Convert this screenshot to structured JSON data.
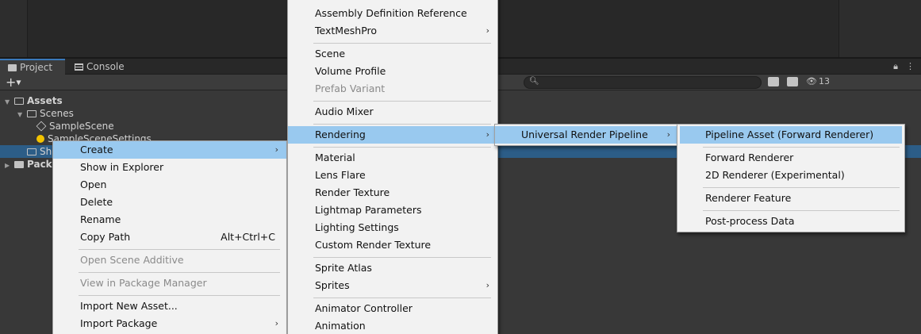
{
  "panel": {
    "tabs": [
      {
        "label": "Project",
        "icon": "folder-icon"
      },
      {
        "label": "Console",
        "icon": "console-icon"
      }
    ],
    "hidden_count": "13",
    "search_placeholder": ""
  },
  "tree": {
    "assets": "Assets",
    "scenes": "Scenes",
    "sample_scene": "SampleScene",
    "sample_scene_settings": "SampleSceneSettings",
    "selected_folder": "Sh",
    "packages": "Pack"
  },
  "context_menu": {
    "items": [
      {
        "label": "Create",
        "submenu": true,
        "highlighted": true
      },
      {
        "label": "Show in Explorer"
      },
      {
        "label": "Open"
      },
      {
        "label": "Delete"
      },
      {
        "label": "Rename"
      },
      {
        "label": "Copy Path",
        "shortcut": "Alt+Ctrl+C"
      },
      {
        "label": "Open Scene Additive",
        "disabled": true
      },
      {
        "label": "View in Package Manager",
        "disabled": true
      },
      {
        "label": "Import New Asset..."
      },
      {
        "label": "Import Package",
        "submenu": true
      }
    ]
  },
  "create_menu": {
    "items": [
      {
        "label": "Assembly Definition Reference"
      },
      {
        "label": "TextMeshPro",
        "submenu": true
      },
      {
        "label": "Scene"
      },
      {
        "label": "Volume Profile"
      },
      {
        "label": "Prefab Variant",
        "disabled": true
      },
      {
        "label": "Audio Mixer"
      },
      {
        "label": "Rendering",
        "submenu": true,
        "highlighted": true
      },
      {
        "label": "Material"
      },
      {
        "label": "Lens Flare"
      },
      {
        "label": "Render Texture"
      },
      {
        "label": "Lightmap Parameters"
      },
      {
        "label": "Lighting Settings"
      },
      {
        "label": "Custom Render Texture"
      },
      {
        "label": "Sprite Atlas"
      },
      {
        "label": "Sprites",
        "submenu": true
      },
      {
        "label": "Animator Controller"
      },
      {
        "label": "Animation"
      }
    ]
  },
  "rendering_menu": {
    "items": [
      {
        "label": "Universal Render Pipeline",
        "submenu": true,
        "highlighted": true
      }
    ]
  },
  "urp_menu": {
    "items": [
      {
        "label": "Pipeline Asset (Forward Renderer)",
        "highlighted": true
      },
      {
        "label": "Forward Renderer"
      },
      {
        "label": "2D Renderer (Experimental)"
      },
      {
        "label": "Renderer Feature"
      },
      {
        "label": "Post-process Data"
      }
    ]
  },
  "colors": {
    "highlight": "#99c9ef",
    "menu_bg": "#f2f2f2",
    "selection": "#2c5d87",
    "editor_bg": "#383838"
  }
}
